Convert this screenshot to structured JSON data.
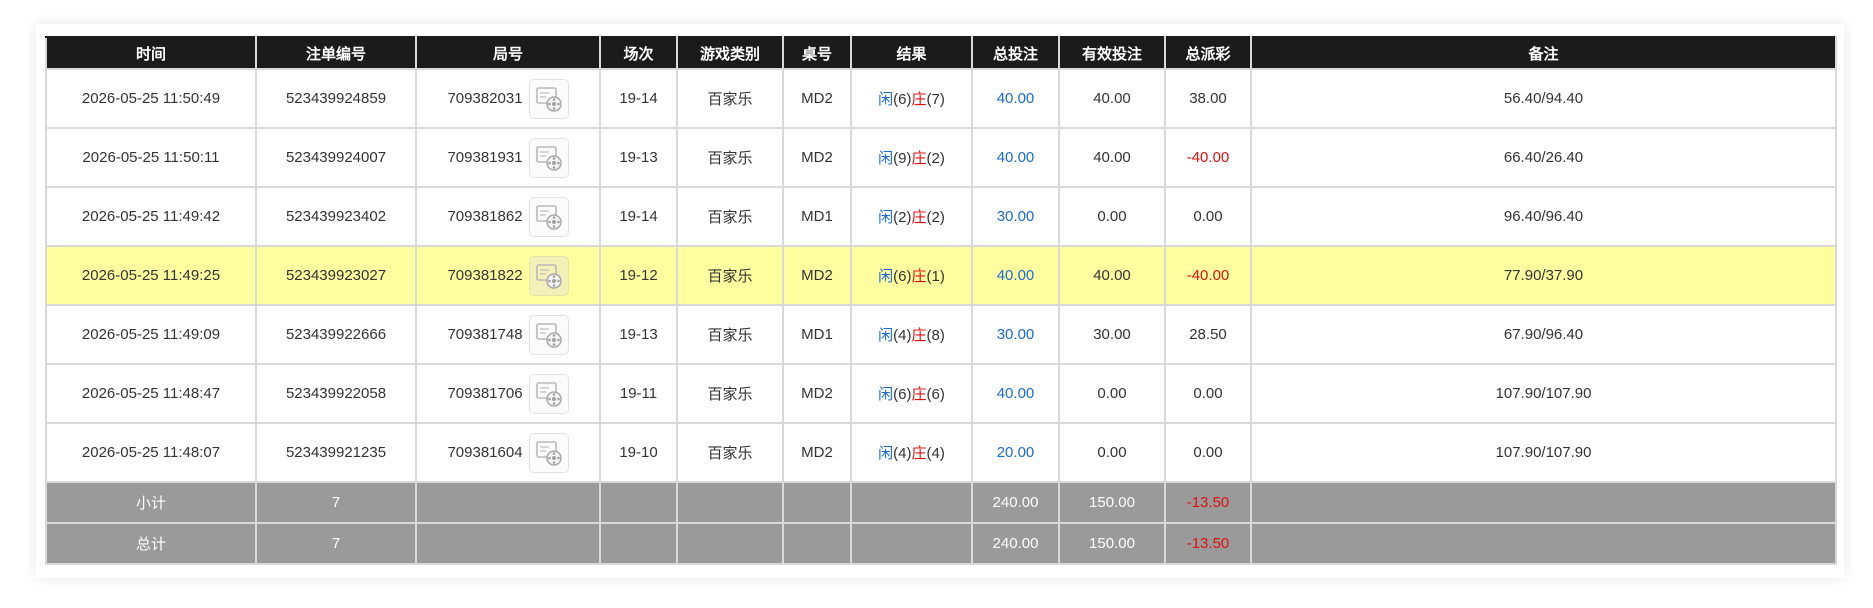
{
  "columns": [
    "时间",
    "注单编号",
    "局号",
    "场次",
    "游戏类别",
    "桌号",
    "结果",
    "总投注",
    "有效投注",
    "总派彩",
    "备注"
  ],
  "rows": [
    {
      "time": "2026-05-25 11:50:49",
      "bet_no": "523439924859",
      "round": "709382031",
      "shoe": "19-14",
      "game": "百家乐",
      "table": "MD2",
      "player_label": "闲",
      "player_score": "(6)",
      "banker_label": "庄",
      "banker_score": "(7)",
      "total_bet": "40.00",
      "valid_bet": "40.00",
      "payout": "38.00",
      "remark": "56.40/94.40",
      "payout_negative": false,
      "highlight": false
    },
    {
      "time": "2026-05-25 11:50:11",
      "bet_no": "523439924007",
      "round": "709381931",
      "shoe": "19-13",
      "game": "百家乐",
      "table": "MD2",
      "player_label": "闲",
      "player_score": "(9)",
      "banker_label": "庄",
      "banker_score": "(2)",
      "total_bet": "40.00",
      "valid_bet": "40.00",
      "payout": "-40.00",
      "remark": "66.40/26.40",
      "payout_negative": true,
      "highlight": false
    },
    {
      "time": "2026-05-25 11:49:42",
      "bet_no": "523439923402",
      "round": "709381862",
      "shoe": "19-14",
      "game": "百家乐",
      "table": "MD1",
      "player_label": "闲",
      "player_score": "(2)",
      "banker_label": "庄",
      "banker_score": "(2)",
      "total_bet": "30.00",
      "valid_bet": "0.00",
      "payout": "0.00",
      "remark": "96.40/96.40",
      "payout_negative": false,
      "highlight": false
    },
    {
      "time": "2026-05-25 11:49:25",
      "bet_no": "523439923027",
      "round": "709381822",
      "shoe": "19-12",
      "game": "百家乐",
      "table": "MD2",
      "player_label": "闲",
      "player_score": "(6)",
      "banker_label": "庄",
      "banker_score": "(1)",
      "total_bet": "40.00",
      "valid_bet": "40.00",
      "payout": "-40.00",
      "remark": "77.90/37.90",
      "payout_negative": true,
      "highlight": true
    },
    {
      "time": "2026-05-25 11:49:09",
      "bet_no": "523439922666",
      "round": "709381748",
      "shoe": "19-13",
      "game": "百家乐",
      "table": "MD1",
      "player_label": "闲",
      "player_score": "(4)",
      "banker_label": "庄",
      "banker_score": "(8)",
      "total_bet": "30.00",
      "valid_bet": "30.00",
      "payout": "28.50",
      "remark": "67.90/96.40",
      "payout_negative": false,
      "highlight": false
    },
    {
      "time": "2026-05-25 11:48:47",
      "bet_no": "523439922058",
      "round": "709381706",
      "shoe": "19-11",
      "game": "百家乐",
      "table": "MD2",
      "player_label": "闲",
      "player_score": "(6)",
      "banker_label": "庄",
      "banker_score": "(6)",
      "total_bet": "40.00",
      "valid_bet": "0.00",
      "payout": "0.00",
      "remark": "107.90/107.90",
      "payout_negative": false,
      "highlight": false
    },
    {
      "time": "2026-05-25 11:48:07",
      "bet_no": "523439921235",
      "round": "709381604",
      "shoe": "19-10",
      "game": "百家乐",
      "table": "MD2",
      "player_label": "闲",
      "player_score": "(4)",
      "banker_label": "庄",
      "banker_score": "(4)",
      "total_bet": "20.00",
      "valid_bet": "0.00",
      "payout": "0.00",
      "remark": "107.90/107.90",
      "payout_negative": false,
      "highlight": false
    }
  ],
  "subtotal": {
    "label": "小计",
    "count": "7",
    "total_bet": "240.00",
    "valid_bet": "150.00",
    "payout": "-13.50"
  },
  "grand_total": {
    "label": "总计",
    "count": "7",
    "total_bet": "240.00",
    "valid_bet": "150.00",
    "payout": "-13.50"
  },
  "icons": {
    "replay": "video-replay-icon"
  },
  "colors": {
    "header_bg": "#1b1b1b",
    "highlight_row": "#ffffa0",
    "bet_blue": "#1a6ad6",
    "negative_red": "#e01010",
    "footer_bg": "#9a9a9a"
  }
}
